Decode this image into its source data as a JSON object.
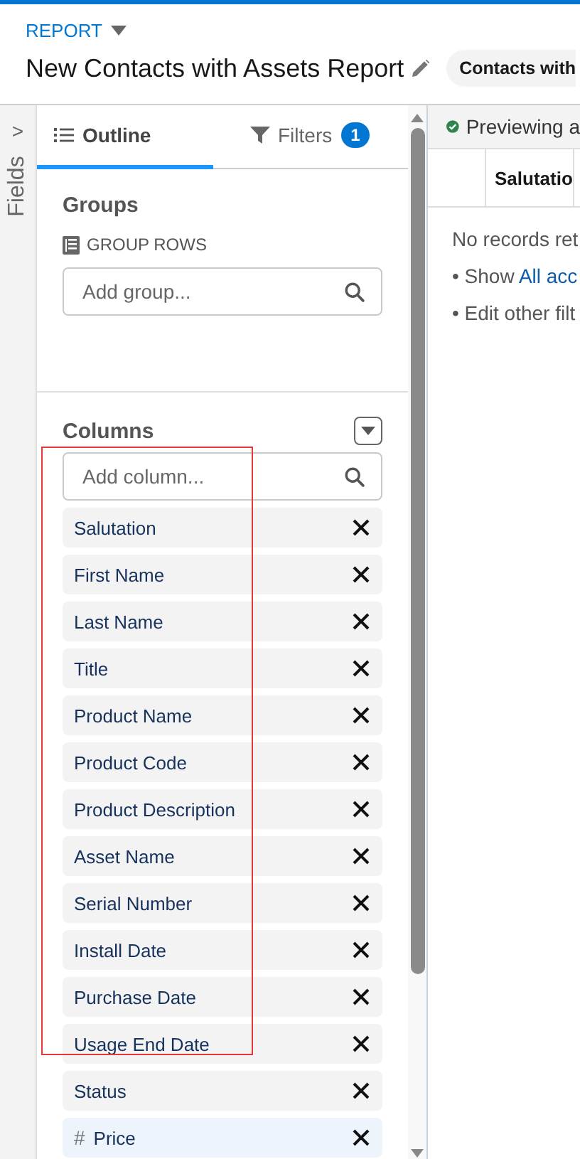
{
  "header": {
    "object_type": "REPORT",
    "title": "New Contacts with Assets Report",
    "report_type": "Contacts with"
  },
  "fields_toggle": {
    "label": "Fields",
    "arrow": ">"
  },
  "tabs": [
    {
      "label": "Outline",
      "selected": true,
      "kind": "outline"
    },
    {
      "label": "Filters",
      "selected": false,
      "kind": "filters",
      "count": "1"
    }
  ],
  "groups": {
    "title": "Groups",
    "subtitle": "GROUP ROWS",
    "search": {
      "placeholder": "Add group..."
    }
  },
  "columns": {
    "title": "Columns",
    "search": {
      "placeholder": "Add column..."
    },
    "items": [
      {
        "label": "Salutation",
        "kind": "text"
      },
      {
        "label": "First Name",
        "kind": "text"
      },
      {
        "label": "Last Name",
        "kind": "text"
      },
      {
        "label": "Title",
        "kind": "text"
      },
      {
        "label": "Product Name",
        "kind": "text"
      },
      {
        "label": "Product Code",
        "kind": "text"
      },
      {
        "label": "Product Description",
        "kind": "text"
      },
      {
        "label": "Asset Name",
        "kind": "text"
      },
      {
        "label": "Serial Number",
        "kind": "text"
      },
      {
        "label": "Install Date",
        "kind": "text"
      },
      {
        "label": "Purchase Date",
        "kind": "text"
      },
      {
        "label": "Usage End Date",
        "kind": "text"
      },
      {
        "label": "Status",
        "kind": "text"
      },
      {
        "label": "Price",
        "kind": "number",
        "symbol": "#"
      }
    ]
  },
  "preview": {
    "status": "Previewing a",
    "table_columns": [
      "",
      "Salutatio"
    ],
    "message": "No records ret",
    "hints": [
      {
        "bullet": "•",
        "parts": [
          {
            "text": "Show ",
            "kind": "plain"
          },
          {
            "text": "All acc",
            "kind": "link"
          }
        ]
      },
      {
        "bullet": "•",
        "parts": [
          {
            "text": "Edit other filt",
            "kind": "plain"
          }
        ]
      }
    ]
  },
  "annotation": {
    "kind": "highlight-box"
  }
}
